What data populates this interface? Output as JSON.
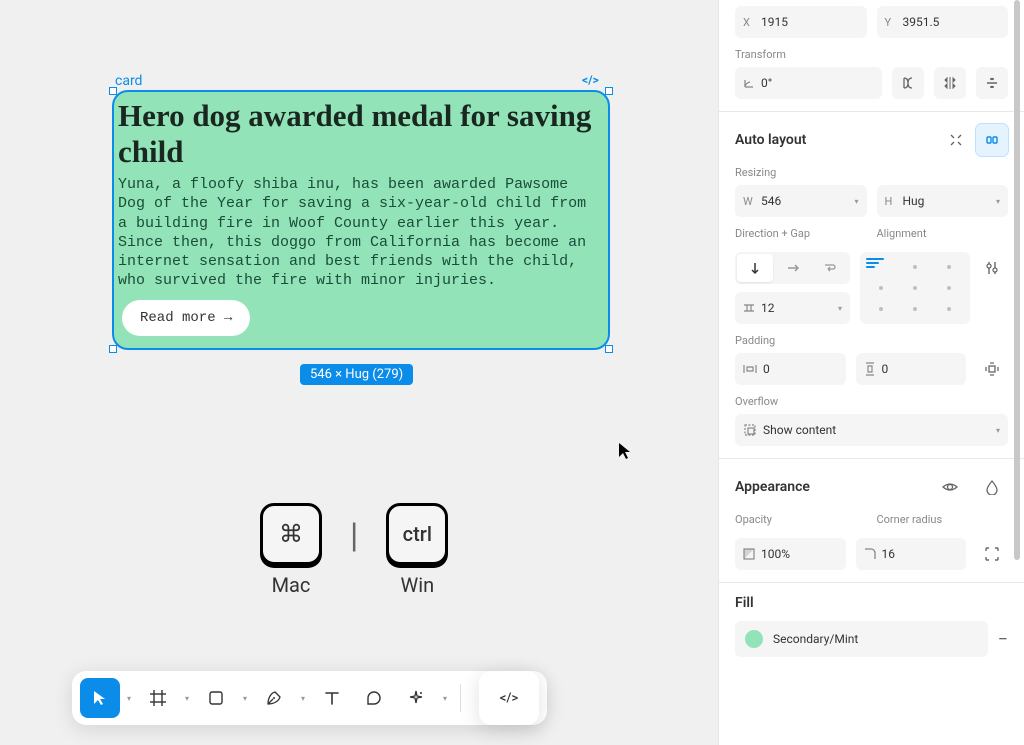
{
  "frame": {
    "label": "card",
    "title": "Hero dog awarded medal for saving child",
    "body": "Yuna, a floofy shiba inu, has been awarded Pawsome Dog of the Year for saving a six-year-old child from a building fire in Woof County earlier this year. Since then, this doggo from California has become an internet sensation and best friends with the child, who survived the fire with minor injuries.",
    "readmore": "Read more →",
    "dimensions": "546 × Hug (279)"
  },
  "shortcuts": {
    "mac_key": "⌘",
    "mac_label": "Mac",
    "win_key": "ctrl",
    "win_label": "Win"
  },
  "panel": {
    "position": {
      "x_label": "X",
      "x": "1915",
      "y_label": "Y",
      "y": "3951.5"
    },
    "transform": {
      "label": "Transform",
      "rotation": "0°"
    },
    "autolayout": {
      "title": "Auto layout",
      "resizing_label": "Resizing",
      "w_label": "W",
      "w": "546",
      "h_label": "H",
      "h": "Hug",
      "direction_label": "Direction + Gap",
      "alignment_label": "Alignment",
      "gap": "12",
      "padding_label": "Padding",
      "pad_h": "0",
      "pad_v": "0",
      "overflow_label": "Overflow",
      "overflow_value": "Show content"
    },
    "appearance": {
      "title": "Appearance",
      "opacity_label": "Opacity",
      "opacity": "100%",
      "radius_label": "Corner radius",
      "radius": "16"
    },
    "fill": {
      "title": "Fill",
      "name": "Secondary/Mint"
    }
  }
}
